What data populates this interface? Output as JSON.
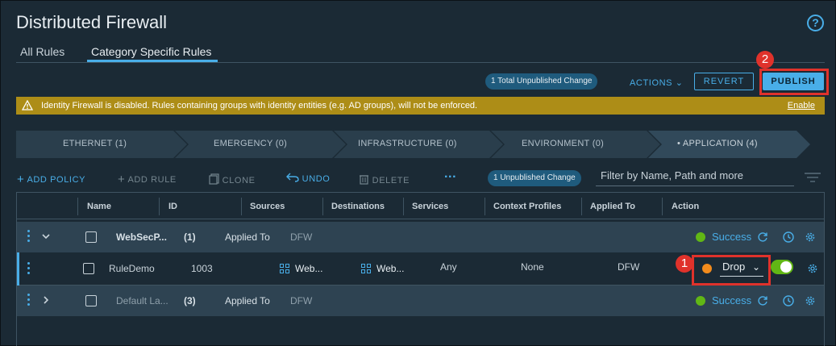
{
  "page": {
    "title": "Distributed Firewall",
    "help_icon": "?"
  },
  "tabs": [
    {
      "label": "All Rules"
    },
    {
      "label": "Category Specific Rules"
    }
  ],
  "topbar": {
    "unpublished_badge": "1 Total Unpublished Change",
    "actions_label": "ACTIONS",
    "revert_label": "REVERT",
    "publish_label": "PUBLISH"
  },
  "callouts": {
    "publish": "2",
    "action": "1"
  },
  "warning": {
    "text": "Identity Firewall is disabled. Rules containing groups with identity entities (e.g. AD groups), will not be enforced.",
    "link": "Enable"
  },
  "categories": [
    {
      "label": "ETHERNET (1)"
    },
    {
      "label": "EMERGENCY (0)"
    },
    {
      "label": "INFRASTRUCTURE (0)"
    },
    {
      "label": "ENVIRONMENT (0)"
    },
    {
      "label": "• APPLICATION (4)"
    }
  ],
  "toolbar": {
    "add_policy": "ADD POLICY",
    "add_rule": "ADD RULE",
    "clone": "CLONE",
    "undo": "UNDO",
    "delete": "DELETE",
    "more": "...",
    "unpublished_badge": "1 Unpublished Change",
    "filter_placeholder": "Filter by Name, Path and more"
  },
  "columns": [
    "Name",
    "ID",
    "Sources",
    "Destinations",
    "Services",
    "Context Profiles",
    "Applied To",
    "Action"
  ],
  "rows": [
    {
      "name": "WebSecP...",
      "count": "(1)",
      "applied_label": "Applied To",
      "applied": "DFW",
      "status": "Success"
    },
    {
      "name": "RuleDemo",
      "id": "1003",
      "sources": "Web...",
      "destinations": "Web...",
      "services": "Any",
      "context": "None",
      "applied": "DFW",
      "action": "Drop"
    },
    {
      "name": "Default La...",
      "count": "(3)",
      "applied_label": "Applied To",
      "applied": "DFW",
      "status": "Success"
    }
  ],
  "colors": {
    "accent": "#49aee8",
    "success": "#61b715",
    "warning": "#ad8d17",
    "highlight": "#e0322b"
  }
}
